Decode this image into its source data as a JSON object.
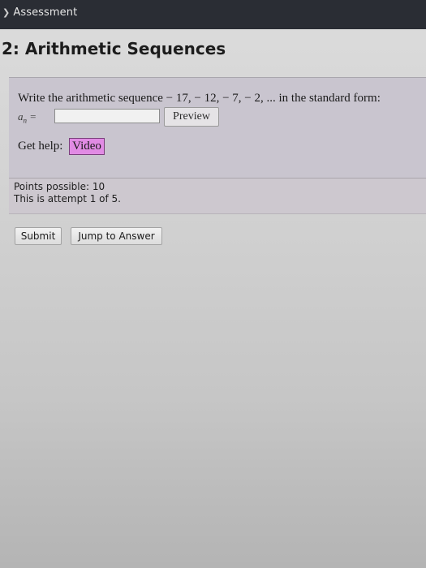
{
  "header": {
    "breadcrumb": "Assessment"
  },
  "page_title": "2: Arithmetic Sequences",
  "question": {
    "prompt": "Write the arithmetic sequence − 17,  − 12,  − 7,  − 2, ... in the standard form:",
    "answer_label": "a",
    "answer_subscript": "n",
    "answer_equals": "=",
    "answer_value": "",
    "preview_label": "Preview",
    "help_label": "Get help:",
    "video_label": "Video"
  },
  "info": {
    "points": "Points possible: 10",
    "attempt": "This is attempt 1 of 5."
  },
  "actions": {
    "submit_label": "Submit",
    "jump_label": "Jump to Answer"
  },
  "colors": {
    "topbar": "#2a2d34",
    "question_bg": "#c9c5cf",
    "video_button": "#e18be4"
  }
}
